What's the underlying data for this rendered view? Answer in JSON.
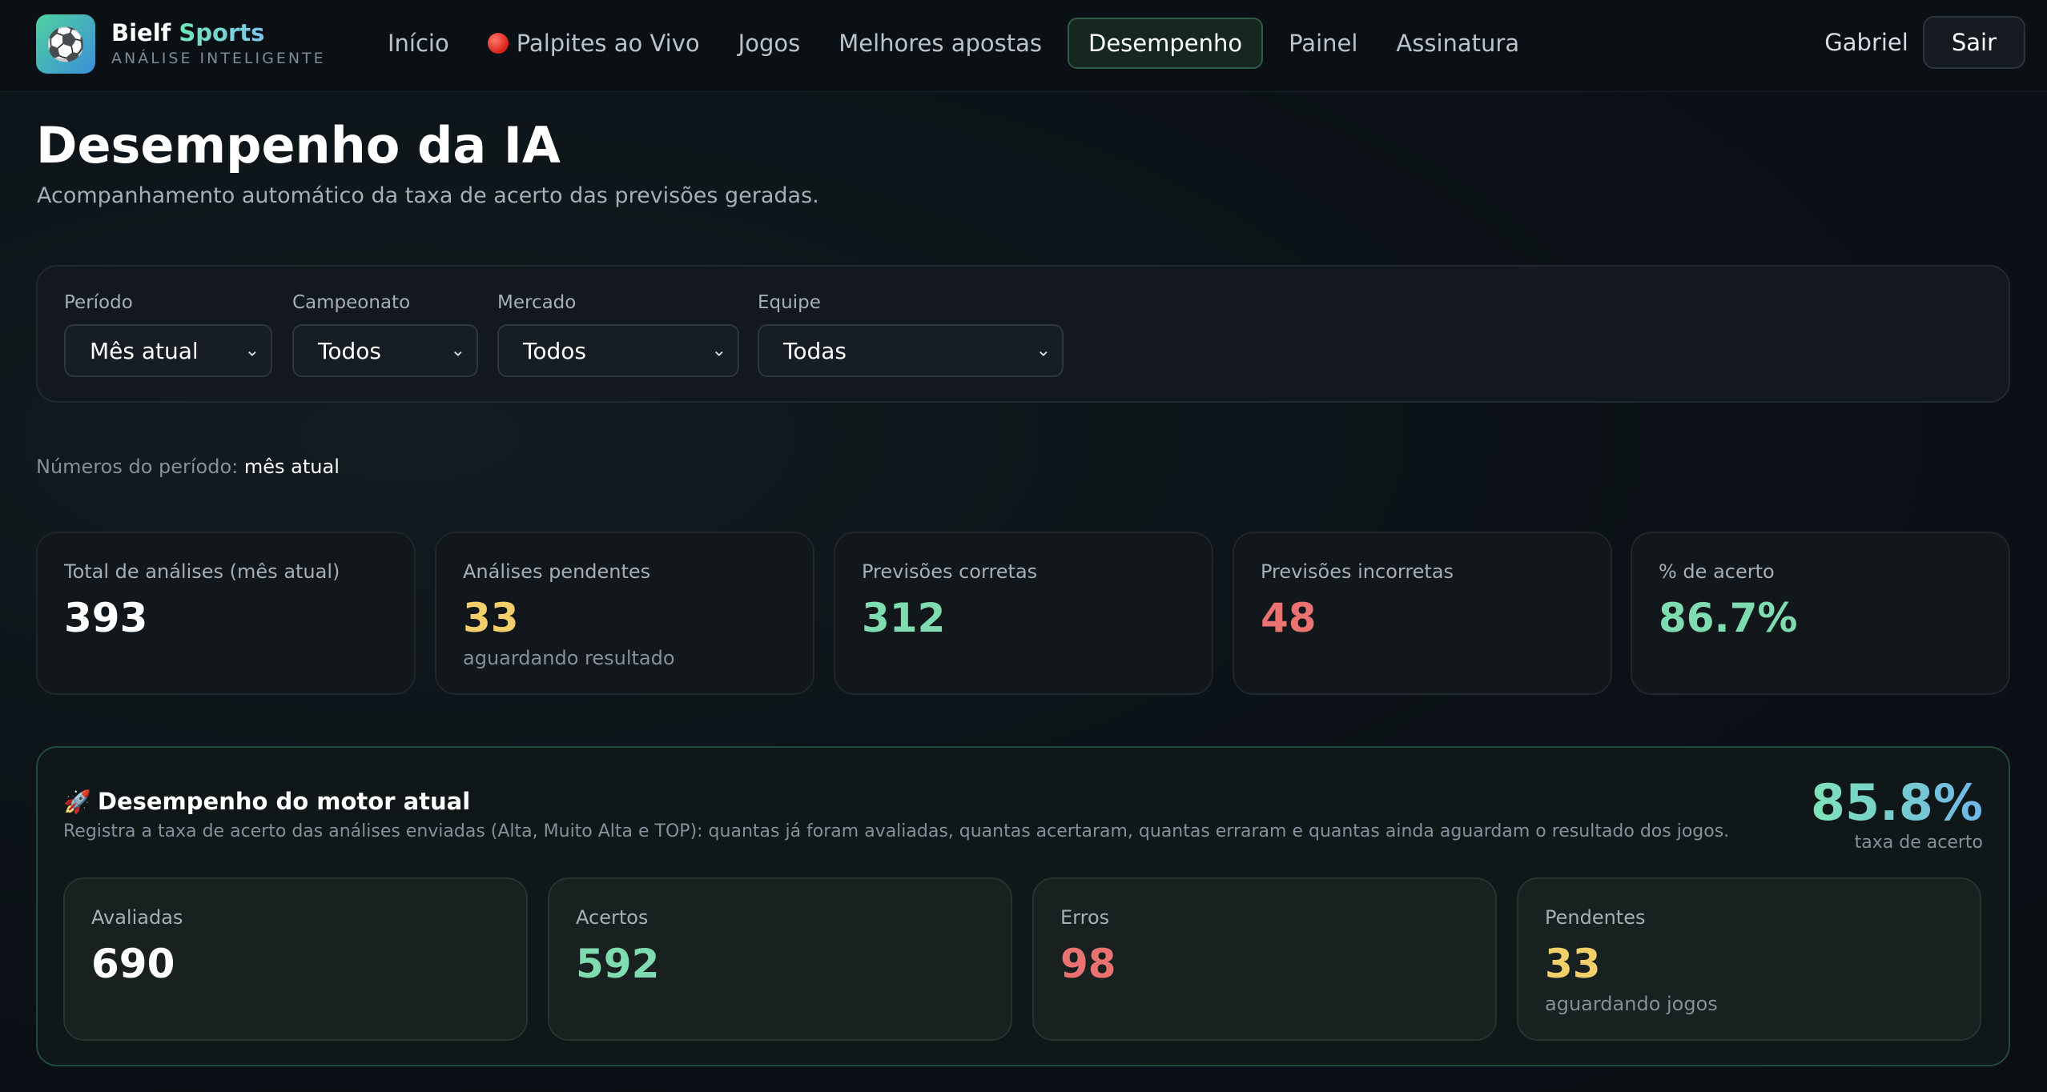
{
  "nav": {
    "logo_icon": "soccer-ball-icon",
    "brand_main": "Bielf",
    "brand_accent": "Sports",
    "tagline": "ANÁLISE INTELIGENTE",
    "links": [
      "Início",
      "Palpites ao Vivo",
      "Jogos",
      "Melhores apostas",
      "Desempenho",
      "Painel",
      "Assinatura"
    ],
    "active": "Desempenho",
    "user_name": "Gabriel",
    "logout_label": "Sair"
  },
  "header": {
    "title": "Desempenho da IA",
    "subtitle": "Acompanhamento automático da taxa de acerto das previsões geradas."
  },
  "filters": {
    "period": {
      "label": "Período",
      "value": "Mês atual"
    },
    "championship": {
      "label": "Campeonato",
      "value": "Todos"
    },
    "market": {
      "label": "Mercado",
      "value": "Todos"
    },
    "team": {
      "label": "Equipe",
      "value": "Todas"
    }
  },
  "period_note": {
    "prefix": "Números do período:",
    "value": "mês atual"
  },
  "stats": {
    "total": {
      "label": "Total de análises (mês atual)",
      "value": "393"
    },
    "pending": {
      "label": "Análises pendentes",
      "value": "33",
      "sub": "aguardando resultado"
    },
    "correct": {
      "label": "Previsões corretas",
      "value": "312"
    },
    "incorrect": {
      "label": "Previsões incorretas",
      "value": "48"
    },
    "accuracy": {
      "label": "% de acerto",
      "value": "86.7%"
    }
  },
  "engine": {
    "title": "Desempenho do motor atual",
    "description": "Registra a taxa de acerto das análises enviadas (Alta, Muito Alta e TOP): quantas já foram avaliadas, quantas acertaram, quantas erraram e quantas ainda aguardam o resultado dos jogos.",
    "rate_value": "85.8%",
    "rate_label": "taxa de acerto",
    "cards": {
      "evaluated": {
        "label": "Avaliadas",
        "value": "690"
      },
      "hits": {
        "label": "Acertos",
        "value": "592"
      },
      "errors": {
        "label": "Erros",
        "value": "98"
      },
      "pending": {
        "label": "Pendentes",
        "value": "33",
        "sub": "aguardando jogos"
      }
    }
  },
  "colors": {
    "accent_green": "#7fdcb0",
    "warning_yellow": "#f2cf6b",
    "error_red": "#ea7372",
    "background": "#0b1116"
  }
}
